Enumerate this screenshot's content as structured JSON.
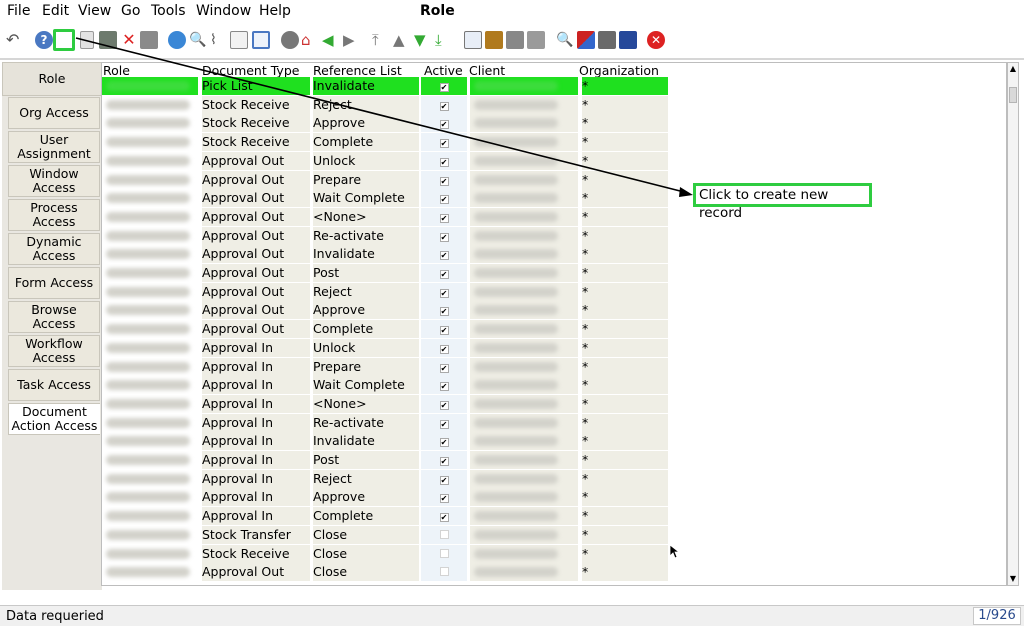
{
  "menu": [
    "File",
    "Edit",
    "View",
    "Go",
    "Tools",
    "Window",
    "Help"
  ],
  "window_title": "Role",
  "toolbar_icons": [
    "undo-icon",
    "help-icon",
    "new-record-icon",
    "copy-record-icon",
    "save-icon",
    "delete-icon",
    "delete-selection-icon",
    "refresh-icon",
    "find-icon",
    "attachment-icon",
    "chat-icon",
    "grid-toggle-icon",
    "history-icon",
    "home-icon",
    "back-icon",
    "forward-icon",
    "first-record-icon",
    "previous-record-icon",
    "next-record-icon",
    "last-record-icon",
    "report-icon",
    "archive-icon",
    "print-preview-icon",
    "print-icon",
    "zoom-across-icon",
    "related-icon",
    "workflow-icon",
    "product-info-icon",
    "close-window-icon"
  ],
  "tabs": [
    "Role",
    "Org Access",
    "User Assignment",
    "Window Access",
    "Process Access",
    "Dynamic Access",
    "Form Access",
    "Browse Access",
    "Workflow Access",
    "Task Access",
    "Document Action Access"
  ],
  "grid": {
    "headers": {
      "role": "Role",
      "document_type": "Document Type",
      "reference_list": "Reference List",
      "active": "Active",
      "client": "Client",
      "organization": "Organization"
    },
    "rows": [
      {
        "doc": "Pick List",
        "ref": "Invalidate",
        "active": true,
        "org": "*"
      },
      {
        "doc": "Stock Receive",
        "ref": "Reject",
        "active": true,
        "org": "*"
      },
      {
        "doc": "Stock Receive",
        "ref": "Approve",
        "active": true,
        "org": "*"
      },
      {
        "doc": "Stock Receive",
        "ref": "Complete",
        "active": true,
        "org": "*"
      },
      {
        "doc": "Approval Out",
        "ref": "Unlock",
        "active": true,
        "org": "*"
      },
      {
        "doc": "Approval Out",
        "ref": "Prepare",
        "active": true,
        "org": "*"
      },
      {
        "doc": "Approval Out",
        "ref": "Wait Complete",
        "active": true,
        "org": "*"
      },
      {
        "doc": "Approval Out",
        "ref": "<None>",
        "active": true,
        "org": "*"
      },
      {
        "doc": "Approval Out",
        "ref": "Re-activate",
        "active": true,
        "org": "*"
      },
      {
        "doc": "Approval Out",
        "ref": "Invalidate",
        "active": true,
        "org": "*"
      },
      {
        "doc": "Approval Out",
        "ref": "Post",
        "active": true,
        "org": "*"
      },
      {
        "doc": "Approval Out",
        "ref": "Reject",
        "active": true,
        "org": "*"
      },
      {
        "doc": "Approval Out",
        "ref": "Approve",
        "active": true,
        "org": "*"
      },
      {
        "doc": "Approval Out",
        "ref": "Complete",
        "active": true,
        "org": "*"
      },
      {
        "doc": "Approval In",
        "ref": "Unlock",
        "active": true,
        "org": "*"
      },
      {
        "doc": "Approval In",
        "ref": "Prepare",
        "active": true,
        "org": "*"
      },
      {
        "doc": "Approval In",
        "ref": "Wait Complete",
        "active": true,
        "org": "*"
      },
      {
        "doc": "Approval In",
        "ref": "<None>",
        "active": true,
        "org": "*"
      },
      {
        "doc": "Approval In",
        "ref": "Re-activate",
        "active": true,
        "org": "*"
      },
      {
        "doc": "Approval In",
        "ref": "Invalidate",
        "active": true,
        "org": "*"
      },
      {
        "doc": "Approval In",
        "ref": "Post",
        "active": true,
        "org": "*"
      },
      {
        "doc": "Approval In",
        "ref": "Reject",
        "active": true,
        "org": "*"
      },
      {
        "doc": "Approval In",
        "ref": "Approve",
        "active": true,
        "org": "*"
      },
      {
        "doc": "Approval In",
        "ref": "Complete",
        "active": true,
        "org": "*"
      },
      {
        "doc": "Stock Transfer",
        "ref": "Close",
        "active": false,
        "org": "*"
      },
      {
        "doc": "Stock Receive",
        "ref": "Close",
        "active": false,
        "org": "*"
      },
      {
        "doc": "Approval Out",
        "ref": "Close",
        "active": false,
        "org": "*"
      }
    ]
  },
  "annotation": "Click to create new record",
  "status": {
    "message": "Data requeried",
    "record_count": "1/926"
  },
  "colors": {
    "highlight": "#2ecc40",
    "selected_row": "#1fe01f"
  }
}
